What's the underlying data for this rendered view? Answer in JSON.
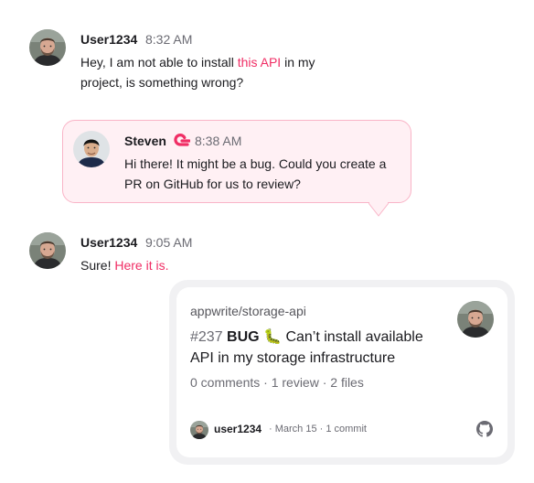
{
  "messages": [
    {
      "user": "User1234",
      "time": "8:32 AM",
      "text_before": "Hey, I am not able to install ",
      "link": "this API",
      "text_after": " in my project, is something wrong?"
    },
    {
      "user": "Steven",
      "time": "8:38 AM",
      "text": "Hi there! It might be a bug. Could you create a PR on GitHub for us to review?"
    },
    {
      "user": "User1234",
      "time": "9:05 AM",
      "text_before": "Sure! ",
      "link": "Here it is."
    }
  ],
  "pr_card": {
    "repo": "appwrite/storage-api",
    "number": "#237",
    "label": "BUG",
    "emoji": "🐛",
    "title": "Can’t install available API in my storage infrastructure",
    "meta": "0 comments · 1 review · 2 files",
    "author": "user1234",
    "details": "· March 15 · 1 commit"
  },
  "icons": {
    "brand": "appwrite-logo-icon",
    "github": "github-icon"
  },
  "colors": {
    "accent": "#f02e65",
    "bubble_bg": "#fff0f4",
    "bubble_border": "#f9b4c7"
  }
}
